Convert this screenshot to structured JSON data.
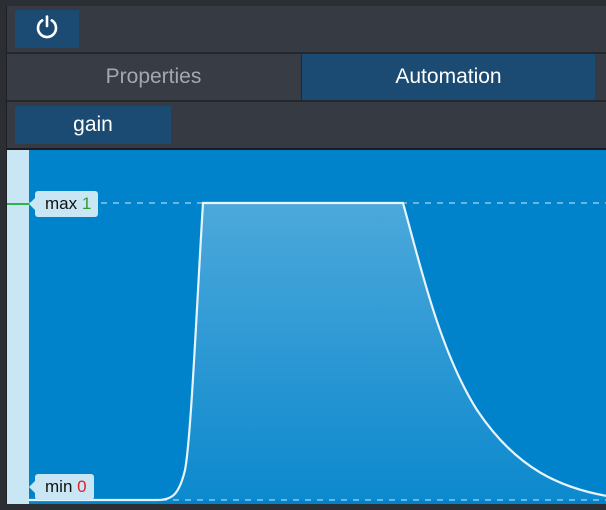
{
  "toolbar": {
    "power_icon": "power-icon"
  },
  "tabs": [
    {
      "label": "Properties",
      "active": false
    },
    {
      "label": "Automation",
      "active": true
    }
  ],
  "parameter": {
    "label": "gain"
  },
  "automation": {
    "max_label": "max",
    "max_value": "1",
    "min_label": "min",
    "min_value": "0",
    "envelope": "attack to max, sustain, exponential decay to min"
  },
  "colors": {
    "graph_bg": "#0083cb",
    "button_bg": "#1b4b72",
    "panel_bg": "#353a42",
    "ruler": "#c9e6f5",
    "max_value_color": "#2ca02c",
    "min_value_color": "#e0202a"
  }
}
